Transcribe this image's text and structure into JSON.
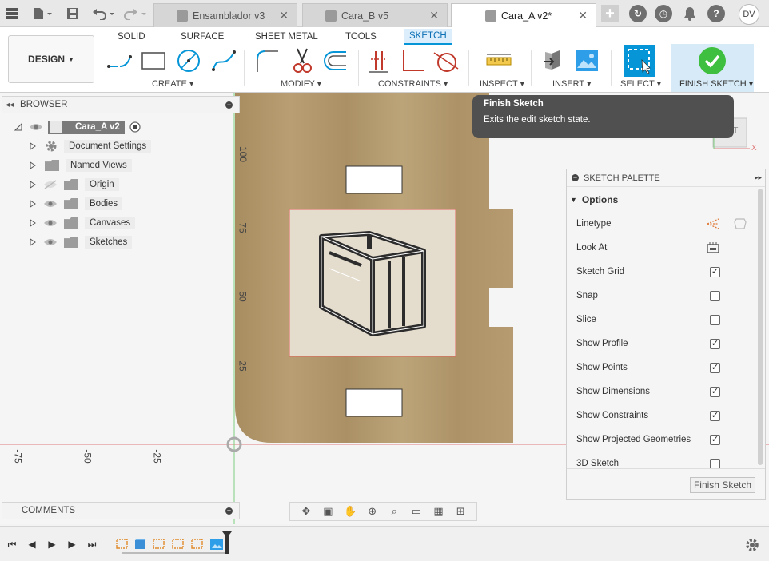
{
  "titlebar": {
    "tabs": [
      {
        "label": "Ensamblador v3",
        "active": false
      },
      {
        "label": "Cara_B v5",
        "active": false
      },
      {
        "label": "Cara_A v2*",
        "active": true
      }
    ],
    "user_initials": "DV",
    "help_label": "?"
  },
  "ribbon": {
    "workspace": "DESIGN",
    "tabs": [
      "SOLID",
      "SURFACE",
      "SHEET METAL",
      "TOOLS",
      "SKETCH"
    ],
    "active_tab": "SKETCH",
    "groups": [
      "CREATE",
      "MODIFY",
      "CONSTRAINTS",
      "INSPECT",
      "INSERT",
      "SELECT",
      "FINISH SKETCH"
    ]
  },
  "browser": {
    "title": "BROWSER",
    "root": "Cara_A v2",
    "items": [
      "Document Settings",
      "Named Views",
      "Origin",
      "Bodies",
      "Canvases",
      "Sketches"
    ]
  },
  "axis_labels": {
    "vertical": [
      "100",
      "75",
      "50",
      "25"
    ],
    "horizontal": [
      "-75",
      "-50",
      "-25"
    ]
  },
  "tooltip": {
    "title": "Finish Sketch",
    "body": "Exits the edit sketch state."
  },
  "view_cube_label": "NT",
  "palette": {
    "title": "SKETCH PALETTE",
    "section": "Options",
    "rows": [
      {
        "label": "Linetype",
        "kind": "icon"
      },
      {
        "label": "Look At",
        "kind": "icon"
      },
      {
        "label": "Sketch Grid",
        "kind": "checkbox",
        "checked": true
      },
      {
        "label": "Snap",
        "kind": "checkbox",
        "checked": false
      },
      {
        "label": "Slice",
        "kind": "checkbox",
        "checked": false
      },
      {
        "label": "Show Profile",
        "kind": "checkbox",
        "checked": true
      },
      {
        "label": "Show Points",
        "kind": "checkbox",
        "checked": true
      },
      {
        "label": "Show Dimensions",
        "kind": "checkbox",
        "checked": true
      },
      {
        "label": "Show Constraints",
        "kind": "checkbox",
        "checked": true
      },
      {
        "label": "Show Projected Geometries",
        "kind": "checkbox",
        "checked": true
      },
      {
        "label": "3D Sketch",
        "kind": "checkbox",
        "checked": false
      }
    ],
    "finish_button": "Finish Sketch"
  },
  "comments": {
    "title": "COMMENTS"
  },
  "colors": {
    "accent": "#0696d7",
    "wood": "#b49a6e",
    "tooltip": "#505050"
  }
}
